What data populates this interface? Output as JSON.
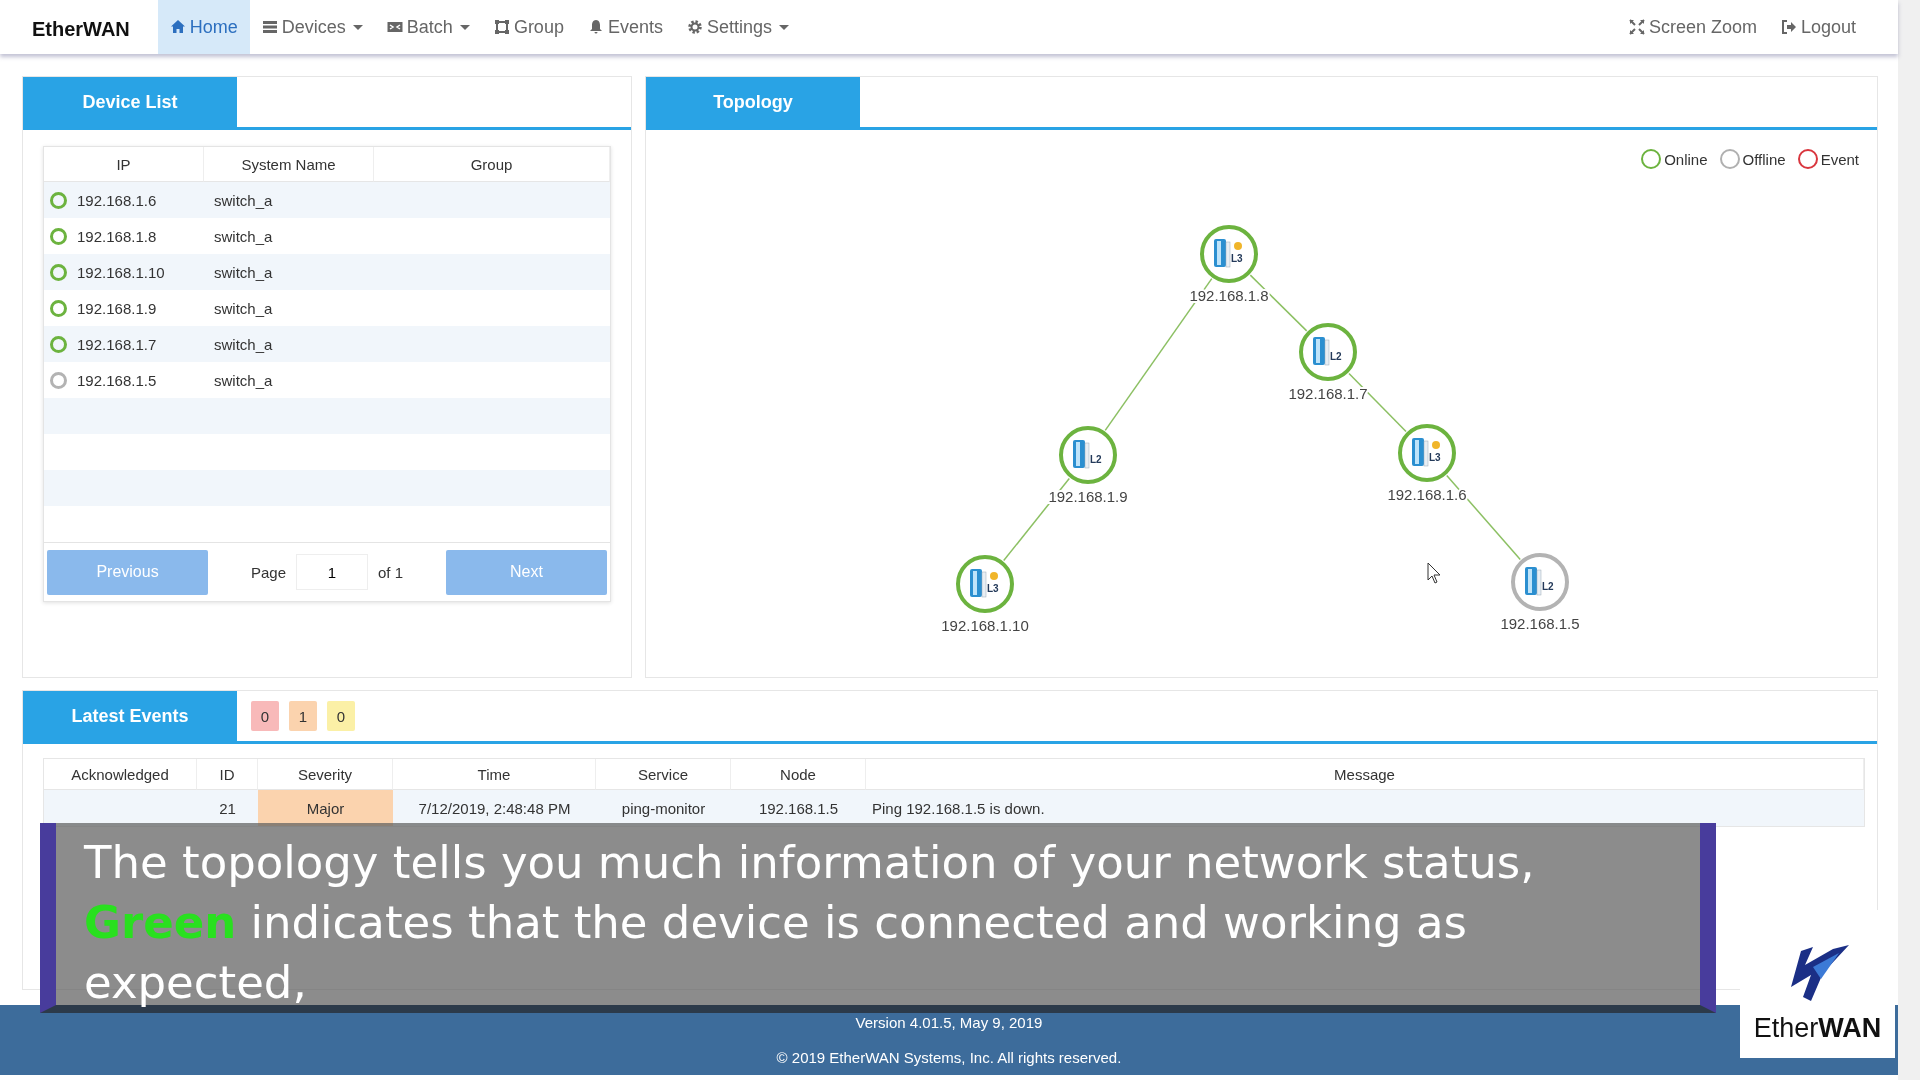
{
  "nav": {
    "brand": "EtherWAN",
    "items": [
      {
        "label": "Home",
        "selected": true,
        "dropdown": false
      },
      {
        "label": "Devices",
        "selected": false,
        "dropdown": true
      },
      {
        "label": "Batch",
        "selected": false,
        "dropdown": true
      },
      {
        "label": "Group",
        "selected": false,
        "dropdown": false
      },
      {
        "label": "Events",
        "selected": false,
        "dropdown": false
      },
      {
        "label": "Settings",
        "selected": false,
        "dropdown": true
      }
    ],
    "right_items": [
      {
        "label": "Screen Zoom"
      },
      {
        "label": "Logout"
      }
    ]
  },
  "device_list": {
    "tab": "Device List",
    "columns": [
      "IP",
      "System Name",
      "Group"
    ],
    "rows": [
      {
        "online": true,
        "ip": "192.168.1.6",
        "system_name": "switch_a"
      },
      {
        "online": true,
        "ip": "192.168.1.8",
        "system_name": "switch_a"
      },
      {
        "online": true,
        "ip": "192.168.1.10",
        "system_name": "switch_a"
      },
      {
        "online": true,
        "ip": "192.168.1.9",
        "system_name": "switch_a"
      },
      {
        "online": true,
        "ip": "192.168.1.7",
        "system_name": "switch_a"
      },
      {
        "online": false,
        "ip": "192.168.1.5",
        "system_name": "switch_a"
      }
    ],
    "pagination": {
      "previous": {
        "label": "Previous",
        "disabled": true
      },
      "page_label": "Page",
      "page_value": "1",
      "of_label": "of 1",
      "next": {
        "label": "Next",
        "disabled": true
      }
    }
  },
  "topology": {
    "tab": "Topology",
    "legend": [
      {
        "label": "Online",
        "color": "#6cb33f"
      },
      {
        "label": "Offline",
        "color": "#b0b0b0"
      },
      {
        "label": "Event",
        "color": "#d9363e"
      }
    ],
    "root": {
      "ip": "192.168.1.8",
      "layer": "L3",
      "online": true,
      "children": [
        {
          "ip": "192.168.1.9",
          "layer": "L2",
          "online": true,
          "children": [
            {
              "ip": "192.168.1.10",
              "layer": "L3",
              "online": true
            }
          ]
        },
        {
          "ip": "192.168.1.7",
          "layer": "L2",
          "online": true,
          "children": [
            {
              "ip": "192.168.1.6",
              "layer": "L3",
              "online": true,
              "children": [
                {
                  "ip": "192.168.1.5",
                  "layer": "L2",
                  "online": false
                }
              ]
            }
          ]
        }
      ]
    }
  },
  "latest_events": {
    "tab": "Latest Events",
    "counters": [
      {
        "value": "0",
        "color": "#f8b9b9"
      },
      {
        "value": "1",
        "color": "#fbd3ae"
      },
      {
        "value": "0",
        "color": "#fbf0a6"
      }
    ],
    "columns": [
      "Acknowledged",
      "ID",
      "Severity",
      "Time",
      "Service",
      "Node",
      "Message"
    ],
    "rows": [
      {
        "acknowledged": false,
        "id": "21",
        "severity": "Major",
        "time": "7/12/2019, 2:48:48 PM",
        "service": "ping-monitor",
        "node": "192.168.1.5",
        "message": "Ping 192.168.1.5 is down."
      }
    ]
  },
  "footer": {
    "version": "Version 4.01.5, May 9, 2019",
    "copyright": "© 2019 EtherWAN Systems, Inc. All rights reserved."
  },
  "subtitle": "The topology tells you much information of your network status, **Green** indicates that the device is connected and working as expected,",
  "corner_logo": "Ether**WAN**"
}
